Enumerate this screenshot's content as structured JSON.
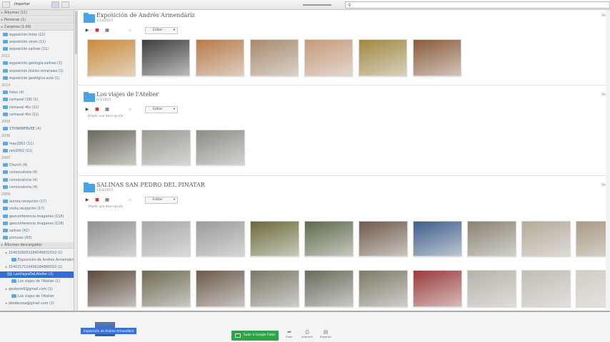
{
  "toolbar": {
    "view_label": "Importar",
    "search_icon": "search-icon"
  },
  "sidebar": {
    "sections": [
      {
        "label": "Álbumes (11)"
      },
      {
        "label": "Personas (1)"
      },
      {
        "label": "Carpetas (1.00)"
      }
    ],
    "rows": [
      {
        "text": "Álbumes (11)",
        "kind": "section"
      },
      {
        "text": "Personas (1)",
        "kind": "section"
      },
      {
        "text": "Carpetas (1.00)",
        "kind": "section"
      },
      {
        "text": "exposición.fotos (11)",
        "kind": "folder"
      },
      {
        "text": "exposición.vinos (11)",
        "kind": "folder"
      },
      {
        "text": "exposición.salinas (11)",
        "kind": "folder"
      },
      {
        "text": "2011",
        "kind": "year"
      },
      {
        "text": "exposición.geología.salinas (1)",
        "kind": "folder"
      },
      {
        "text": "exposición.fósiles.minerales (1)",
        "kind": "folder"
      },
      {
        "text": "exposición.geológica.aula (1)",
        "kind": "folder"
      },
      {
        "text": "2010",
        "kind": "year"
      },
      {
        "text": "fotos (4)",
        "kind": "folder"
      },
      {
        "text": "carnaval (18) (1)",
        "kind": "folder"
      },
      {
        "text": "carnaval 4to (11)",
        "kind": "folder"
      },
      {
        "text": "carnaval 4to (11)",
        "kind": "folder"
      },
      {
        "text": "2009",
        "kind": "year"
      },
      {
        "text": "1THNMBFRVEE (4)",
        "kind": "folder"
      },
      {
        "text": "2008",
        "kind": "year"
      },
      {
        "text": "may2002 (11)",
        "kind": "folder"
      },
      {
        "text": "nov2002 (11)",
        "kind": "folder"
      },
      {
        "text": "2007",
        "kind": "year"
      },
      {
        "text": "Church (4)",
        "kind": "folder"
      },
      {
        "text": "convocatoria (4)",
        "kind": "folder"
      },
      {
        "text": "convocatoria (4)",
        "kind": "folder"
      },
      {
        "text": "convocatoria (4)",
        "kind": "folder"
      },
      {
        "text": "2004",
        "kind": "year"
      },
      {
        "text": "aurora.recepción (17)",
        "kind": "folder"
      },
      {
        "text": "visita.recepción (17)",
        "kind": "folder"
      },
      {
        "text": "geoconferencia.imagenes (118)",
        "kind": "folder"
      },
      {
        "text": "geoconferencia.imagenes (118)",
        "kind": "folder"
      },
      {
        "text": "salinas (42)",
        "kind": "folder"
      },
      {
        "text": "pinturas (43)",
        "kind": "folder"
      },
      {
        "text": "Álbumes descargados",
        "kind": "section"
      },
      {
        "text": "1540326002284046832010 (1)",
        "kind": "sub"
      },
      {
        "text": "Exposición de Andrés Armendáriz",
        "kind": "subfolder"
      },
      {
        "text": "1540217116406184860010 (1)",
        "kind": "sub"
      },
      {
        "text": "LosViajesDeLAtelier (1)",
        "kind": "selected"
      },
      {
        "text": "Los viajes de l'Atelier (1)",
        "kind": "subfolder"
      },
      {
        "text": "geoterm6@gmail.com (1)",
        "kind": "sub"
      },
      {
        "text": "Los viajes de l'Atelier",
        "kind": "subfolder"
      },
      {
        "text": "desdecasa@gmail.com (1)",
        "kind": "sub"
      }
    ]
  },
  "albums": [
    {
      "title": "Exposición de Andrés Armendáriz",
      "date": "1/12/2015",
      "edit_label": "Editar",
      "description": "",
      "minibtn": "Ver",
      "photos": [
        {
          "color": "#c98a3a"
        },
        {
          "color": "#3d3d3d"
        },
        {
          "color": "#b77a4a"
        },
        {
          "color": "#a78a6c"
        },
        {
          "color": "#c69a7a"
        },
        {
          "color": "#a08840"
        },
        {
          "color": "#8a5a3a"
        }
      ]
    },
    {
      "title": "Los viajes de l'Atelier",
      "date": "6/3/2015",
      "edit_label": "Editar",
      "description": "Añadir una descripción",
      "minibtn": "Ver",
      "photos": [
        {
          "color": "#6c6a5c"
        },
        {
          "color": "#9a9a92"
        },
        {
          "color": "#8a8e86"
        }
      ]
    },
    {
      "title": "SALINAS SAN PEDRO DEL PINATAR",
      "date": "11/4/2015",
      "edit_label": "Editar",
      "description": "Añadir una descripción",
      "minibtn": "Ver",
      "photos_row1": [
        {
          "color": "#8f9090"
        },
        {
          "color": "#a6a8a4"
        },
        {
          "color": "#9a9b98"
        },
        {
          "color": "#6b6a3a"
        },
        {
          "color": "#5d6a4a"
        },
        {
          "color": "#6e5a4a"
        },
        {
          "color": "#3e5e8a"
        },
        {
          "color": "#8a8372"
        },
        {
          "color": "#b4aa98"
        },
        {
          "color": "#a89a84"
        }
      ],
      "photos_row2": [
        {
          "color": "#5a4a3a"
        },
        {
          "color": "#6e6a52"
        },
        {
          "color": "#6a5a4a"
        },
        {
          "color": "#7a7866"
        },
        {
          "color": "#6a6a5a"
        },
        {
          "color": "#7e7a68"
        },
        {
          "color": "#9a3a3a"
        },
        {
          "color": "#b8b2a8"
        },
        {
          "color": "#c2bcb2"
        },
        {
          "color": "#d2cdc4"
        }
      ]
    }
  ],
  "bottom": {
    "selected_caption": "Exposición de Andrés Armendáriz",
    "share_button": "Subir a Google Fotos",
    "actions": [
      {
        "label": "Subir",
        "icon": "share-icon"
      },
      {
        "label": "Imprimir",
        "icon": "print-icon"
      },
      {
        "label": "Exportar",
        "icon": "export-icon"
      }
    ]
  }
}
